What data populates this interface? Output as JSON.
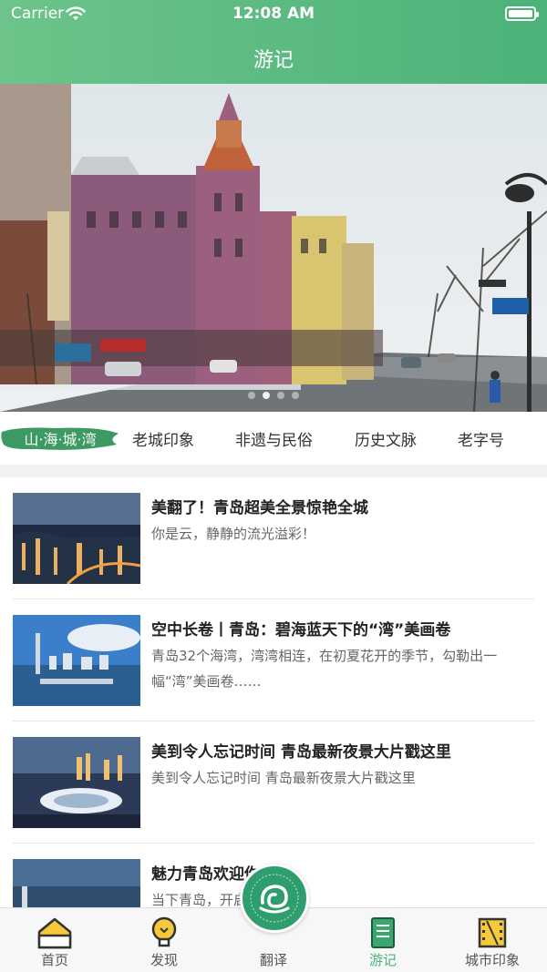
{
  "status_bar": {
    "carrier": "Carrier",
    "time": "12:08 AM"
  },
  "header": {
    "title": "游记"
  },
  "banner": {
    "dot_count": 4,
    "active_dot": 1
  },
  "tabs": [
    {
      "label": "山·海·城·湾",
      "active": true
    },
    {
      "label": "老城印象",
      "active": false
    },
    {
      "label": "非遗与民俗",
      "active": false
    },
    {
      "label": "历史文脉",
      "active": false
    },
    {
      "label": "老字号",
      "active": false
    }
  ],
  "articles": [
    {
      "title": "美翻了！青岛超美全景惊艳全城",
      "desc": "你是云，静静的流光溢彩！"
    },
    {
      "title": "空中长卷丨青岛：碧海蓝天下的“湾”美画卷",
      "desc": "青岛32个海湾，湾湾相连，在初夏花开的季节，勾勒出一幅“湾”美画卷……"
    },
    {
      "title": "美到令人忘记时间 青岛最新夜景大片戳这里",
      "desc": "美到令人忘记时间 青岛最新夜景大片戳这里"
    },
    {
      "title": "魅力青岛欢迎你",
      "desc": "当下青岛，开启最美季节。"
    }
  ],
  "tabbar": [
    {
      "label": "首页",
      "icon": "home-icon"
    },
    {
      "label": "发现",
      "icon": "lightbulb-icon"
    },
    {
      "label": "翻译",
      "icon": "translate-logo-icon"
    },
    {
      "label": "游记",
      "icon": "notebook-icon",
      "active": true
    },
    {
      "label": "城市印象",
      "icon": "film-icon"
    }
  ],
  "colors": {
    "accent": "#4cb27a",
    "header_start": "#6cc48a"
  }
}
